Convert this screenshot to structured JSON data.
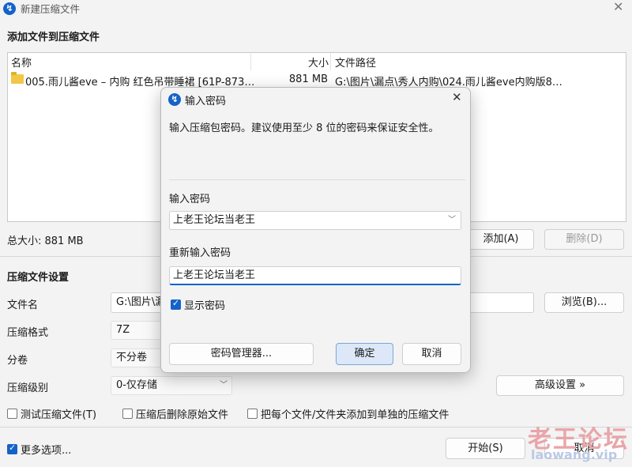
{
  "window": {
    "title": "新建压缩文件",
    "close_glyph": "✕"
  },
  "add_section": {
    "title": "添加文件到压缩文件"
  },
  "file_list": {
    "columns": {
      "name": "名称",
      "size": "大小",
      "path": "文件路径"
    },
    "rows": [
      {
        "name": "005.雨儿酱eve – 内购 红色吊带睡裙 [61P-873…",
        "size": "881 MB",
        "path": "G:\\图片\\漏点\\秀人内购\\024.雨儿酱eve内购版8…"
      }
    ]
  },
  "total_size": "总大小: 881 MB",
  "buttons": {
    "add": "添加(A)",
    "delete": "删除(D)",
    "browse": "浏览(B)...",
    "advanced": "高级设置 »",
    "start": "开始(S)",
    "cancel": "取消"
  },
  "compress_settings": {
    "title": "压缩文件设置",
    "filename_label": "文件名",
    "filename_value": "G:\\图片\\漏",
    "format_label": "压缩格式",
    "format_value": "7Z",
    "volume_label": "分卷",
    "volume_value": "不分卷",
    "level_label": "压缩级别",
    "level_value": "0-仅存储"
  },
  "options": {
    "test": "测试压缩文件(T)",
    "delete_after": "压缩后删除原始文件",
    "separate": "把每个文件/文件夹添加到单独的压缩文件",
    "more": "更多选项..."
  },
  "dialog": {
    "title": "输入密码",
    "hint": "输入压缩包密码。建议使用至少 8 位的密码来保证安全性。",
    "password_label": "输入密码",
    "password_value": "上老王论坛当老王",
    "confirm_label": "重新输入密码",
    "confirm_value": "上老王论坛当老王",
    "show_password": "显示密码",
    "manager": "密码管理器...",
    "ok": "确定",
    "cancel": "取消"
  },
  "watermark": {
    "line1": "老王论坛",
    "line2": "laowang.vip"
  },
  "colors": {
    "accent": "#1463c8",
    "window_bg": "#f3f3f3"
  }
}
